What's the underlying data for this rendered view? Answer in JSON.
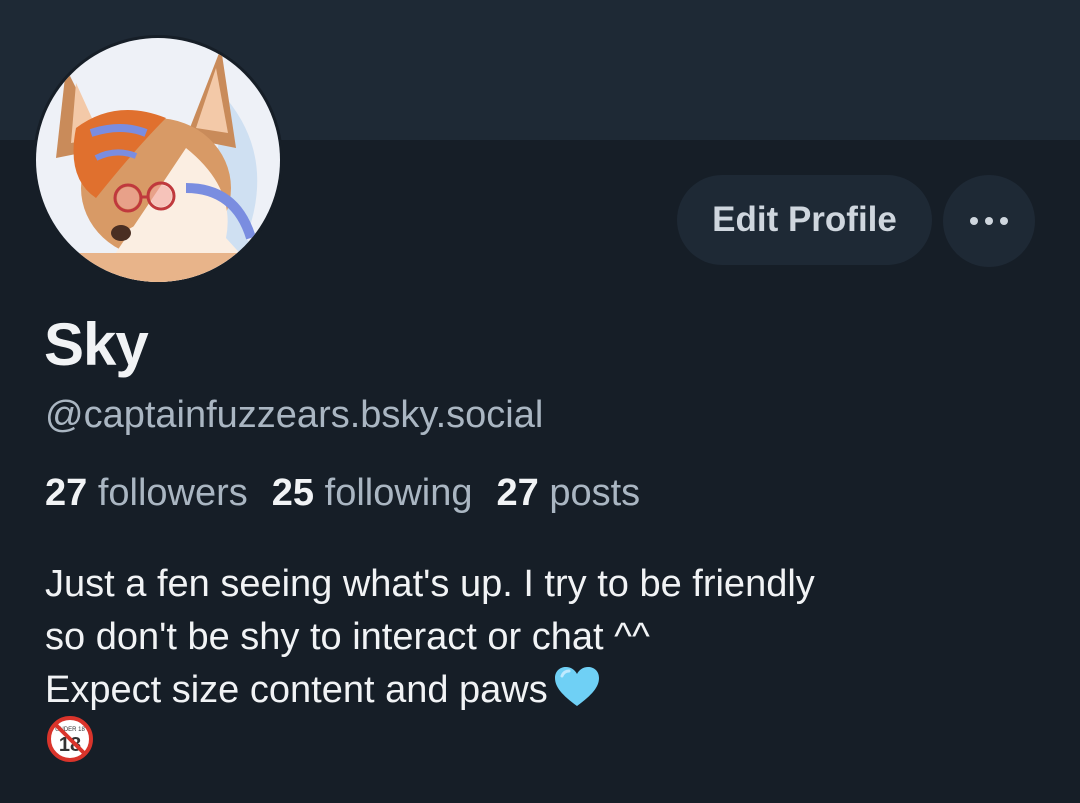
{
  "profile": {
    "display_name": "Sky",
    "handle": "@captainfuzzears.bsky.social",
    "avatar_icon": "fox-character-avatar",
    "stats": [
      {
        "count": "27",
        "label": "followers"
      },
      {
        "count": "25",
        "label": "following"
      },
      {
        "count": "27",
        "label": "posts"
      }
    ],
    "bio_lines": [
      "Just a fen seeing what's up. I try to be friendly",
      "so don't be shy to interact or chat ^^",
      "Expect size content and paws"
    ],
    "bio_emoji": [
      "light-blue-heart-icon",
      "no-under-18-icon"
    ],
    "badge_text": "UNDER 18"
  },
  "actions": {
    "edit_label": "Edit Profile",
    "more_icon": "ellipsis-icon"
  },
  "colors": {
    "background": "#161e27",
    "banner": "#1e2935",
    "button_bg": "#1e2935",
    "text_primary": "#f1f3f5",
    "text_secondary": "#aab6c2",
    "heart": "#6fd0f5",
    "badge_red": "#d9342b"
  }
}
